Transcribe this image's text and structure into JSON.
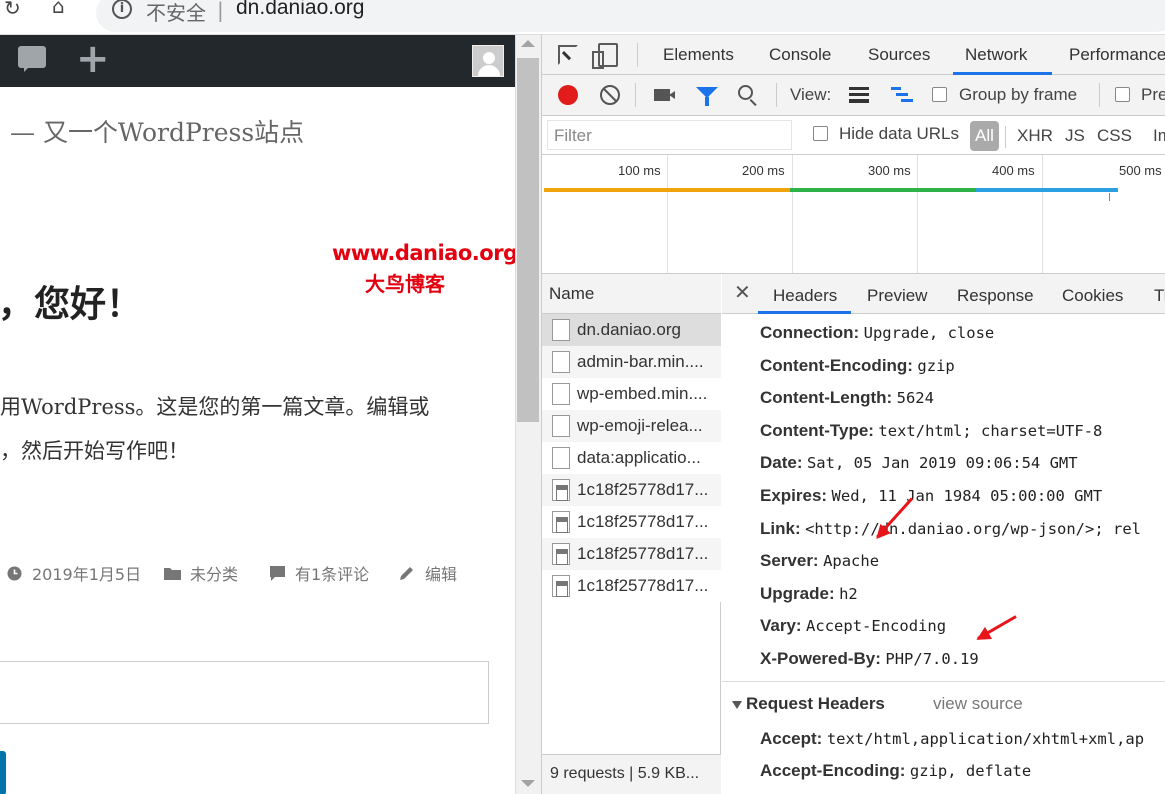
{
  "browser": {
    "insecure_label": "不安全",
    "url": "dn.daniao.org",
    "icons": [
      "reload-icon",
      "home-icon",
      "info-icon"
    ]
  },
  "wp_page": {
    "tagline": "— 又一个WordPress站点",
    "watermark_url": "www.daniao.org",
    "watermark_name": "大鸟博客",
    "post_title": "，您好！",
    "para_line1": "用WordPress。这是您的第一篇文章。编辑或",
    "para_line2": "，然后开始写作吧！",
    "meta_date": "2019年1月5日",
    "meta_category": "未分类",
    "meta_comments": "有1条评论",
    "meta_edit": "编辑"
  },
  "devtools": {
    "tabs": [
      "Elements",
      "Console",
      "Sources",
      "Network",
      "Performance"
    ],
    "active_tab": "Network",
    "toolbar": {
      "view_label": "View:",
      "group_by_frame": "Group by frame",
      "preserve_partial": "Pre"
    },
    "filter_bar": {
      "placeholder": "Filter",
      "hide_data_urls": "Hide data URLs",
      "types": [
        "All",
        "XHR",
        "JS",
        "CSS",
        "Img"
      ]
    },
    "overview_ticks": [
      "100 ms",
      "200 ms",
      "300 ms",
      "400 ms",
      "500 ms"
    ],
    "request_list": {
      "header": "Name",
      "rows": [
        {
          "name": "dn.daniao.org",
          "type": "doc",
          "selected": true
        },
        {
          "name": "admin-bar.min....",
          "type": "doc",
          "selected": false
        },
        {
          "name": "wp-embed.min....",
          "type": "doc",
          "selected": false
        },
        {
          "name": "wp-emoji-relea...",
          "type": "doc",
          "selected": false
        },
        {
          "name": "data:applicatio...",
          "type": "doc",
          "selected": false
        },
        {
          "name": "1c18f25778d17...",
          "type": "img",
          "selected": false
        },
        {
          "name": "1c18f25778d17...",
          "type": "img",
          "selected": false
        },
        {
          "name": "1c18f25778d17...",
          "type": "img",
          "selected": false
        },
        {
          "name": "1c18f25778d17...",
          "type": "img",
          "selected": false
        }
      ],
      "footer": "9 requests | 5.9 KB..."
    },
    "detail": {
      "tabs": [
        "Headers",
        "Preview",
        "Response",
        "Cookies",
        "Ti"
      ],
      "active_tab": "Headers",
      "response_headers": [
        {
          "key": "Connection:",
          "value": "Upgrade, close"
        },
        {
          "key": "Content-Encoding:",
          "value": "gzip"
        },
        {
          "key": "Content-Length:",
          "value": "5624"
        },
        {
          "key": "Content-Type:",
          "value": "text/html; charset=UTF-8"
        },
        {
          "key": "Date:",
          "value": "Sat, 05 Jan 2019 09:06:54 GMT"
        },
        {
          "key": "Expires:",
          "value": "Wed, 11 Jan 1984 05:00:00 GMT"
        },
        {
          "key": "Link:",
          "value": "<http://dn.daniao.org/wp-json/>; rel"
        },
        {
          "key": "Server:",
          "value": "Apache"
        },
        {
          "key": "Upgrade:",
          "value": "h2"
        },
        {
          "key": "Vary:",
          "value": "Accept-Encoding"
        },
        {
          "key": "X-Powered-By:",
          "value": "PHP/7.0.19"
        }
      ],
      "request_section": "Request Headers",
      "view_source": "view source",
      "request_headers": [
        {
          "key": "Accept:",
          "value": "text/html,application/xhtml+xml,ap"
        },
        {
          "key": "Accept-Encoding:",
          "value": "gzip, deflate"
        }
      ]
    }
  }
}
